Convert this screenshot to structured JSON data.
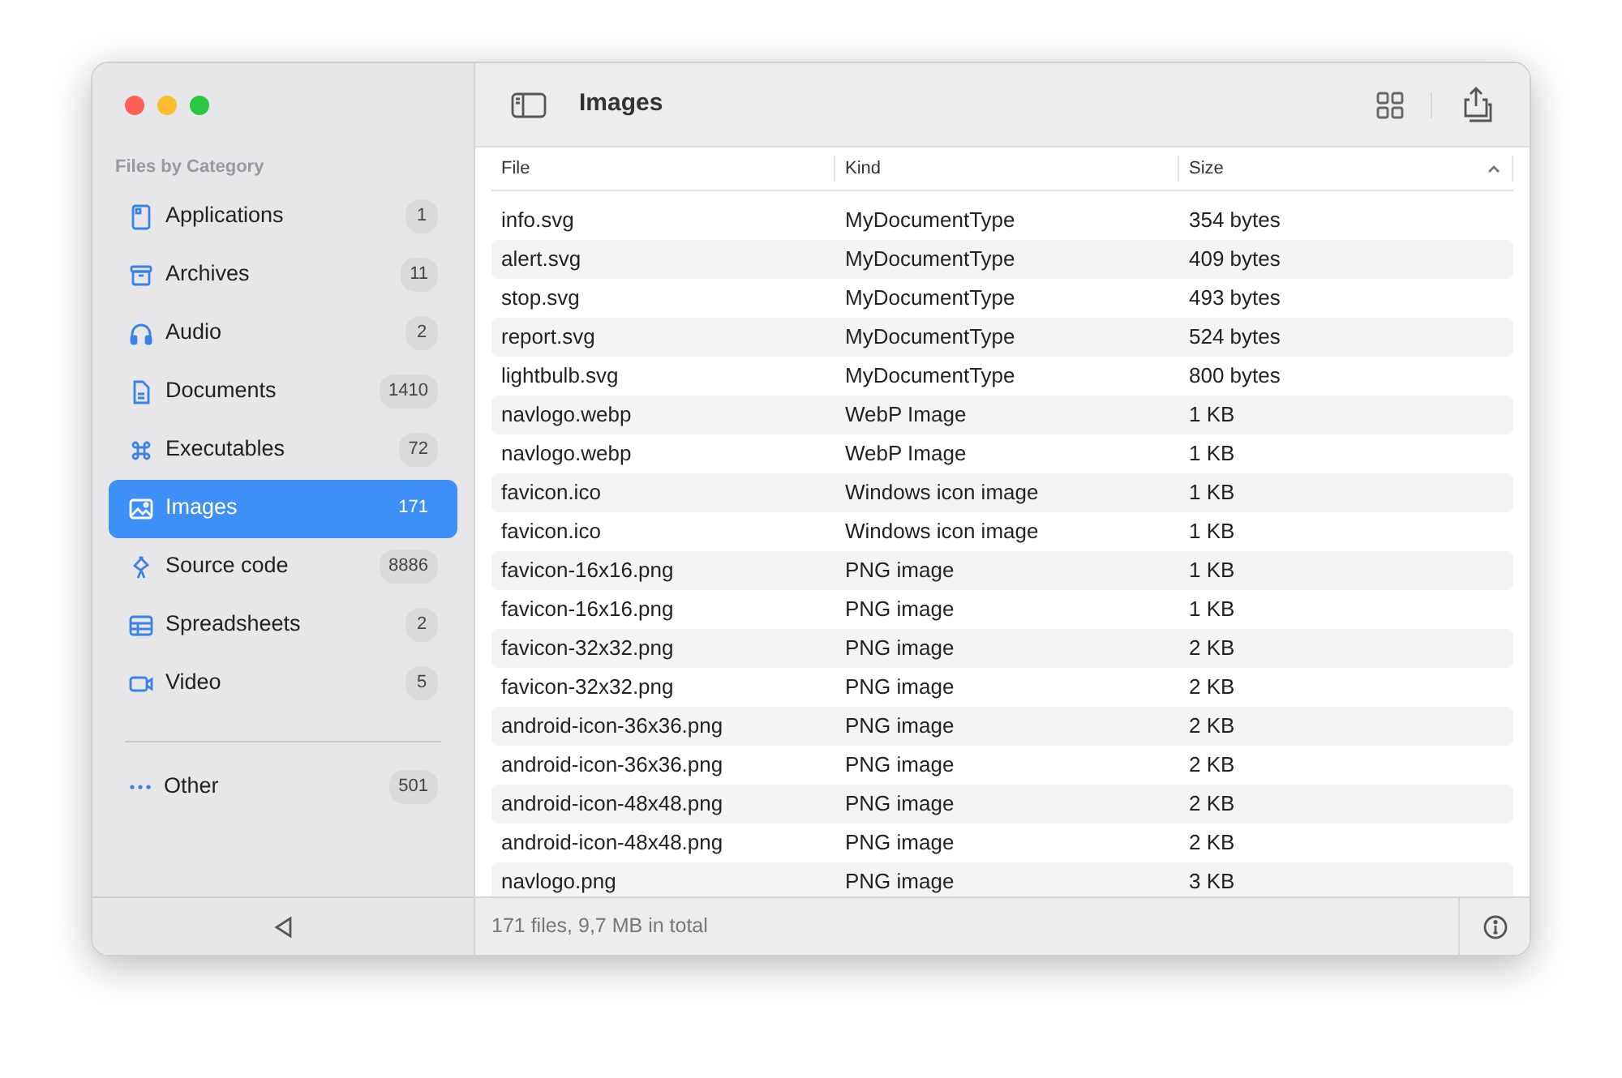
{
  "sidebar": {
    "heading": "Files by Category",
    "items": [
      {
        "label": "Applications",
        "count": "1",
        "selected": false
      },
      {
        "label": "Archives",
        "count": "11",
        "selected": false
      },
      {
        "label": "Audio",
        "count": "2",
        "selected": false
      },
      {
        "label": "Documents",
        "count": "1410",
        "selected": false
      },
      {
        "label": "Executables",
        "count": "72",
        "selected": false
      },
      {
        "label": "Images",
        "count": "171",
        "selected": true
      },
      {
        "label": "Source code",
        "count": "8886",
        "selected": false
      },
      {
        "label": "Spreadsheets",
        "count": "2",
        "selected": false
      },
      {
        "label": "Video",
        "count": "5",
        "selected": false
      }
    ],
    "other_items": [
      {
        "label": "Other",
        "count": "501",
        "selected": false
      }
    ]
  },
  "toolbar": {
    "title": "Images"
  },
  "table": {
    "columns": [
      {
        "label": "File",
        "sorted": false
      },
      {
        "label": "Kind",
        "sorted": false
      },
      {
        "label": "Size",
        "sorted": true
      }
    ],
    "rows": [
      [
        "info.svg",
        "MyDocumentType",
        "354 bytes"
      ],
      [
        "alert.svg",
        "MyDocumentType",
        "409 bytes"
      ],
      [
        "stop.svg",
        "MyDocumentType",
        "493 bytes"
      ],
      [
        "report.svg",
        "MyDocumentType",
        "524 bytes"
      ],
      [
        "lightbulb.svg",
        "MyDocumentType",
        "800 bytes"
      ],
      [
        "navlogo.webp",
        "WebP Image",
        "1 KB"
      ],
      [
        "navlogo.webp",
        "WebP Image",
        "1 KB"
      ],
      [
        "favicon.ico",
        "Windows icon image",
        "1 KB"
      ],
      [
        "favicon.ico",
        "Windows icon image",
        "1 KB"
      ],
      [
        "favicon-16x16.png",
        "PNG image",
        "1 KB"
      ],
      [
        "favicon-16x16.png",
        "PNG image",
        "1 KB"
      ],
      [
        "favicon-32x32.png",
        "PNG image",
        "2 KB"
      ],
      [
        "favicon-32x32.png",
        "PNG image",
        "2 KB"
      ],
      [
        "android-icon-36x36.png",
        "PNG image",
        "2 KB"
      ],
      [
        "android-icon-36x36.png",
        "PNG image",
        "2 KB"
      ],
      [
        "android-icon-48x48.png",
        "PNG image",
        "2 KB"
      ],
      [
        "android-icon-48x48.png",
        "PNG image",
        "2 KB"
      ],
      [
        "navlogo.png",
        "PNG image",
        "3 KB"
      ]
    ]
  },
  "status_bar": {
    "text": "171 files, 9,7 MB in total"
  }
}
